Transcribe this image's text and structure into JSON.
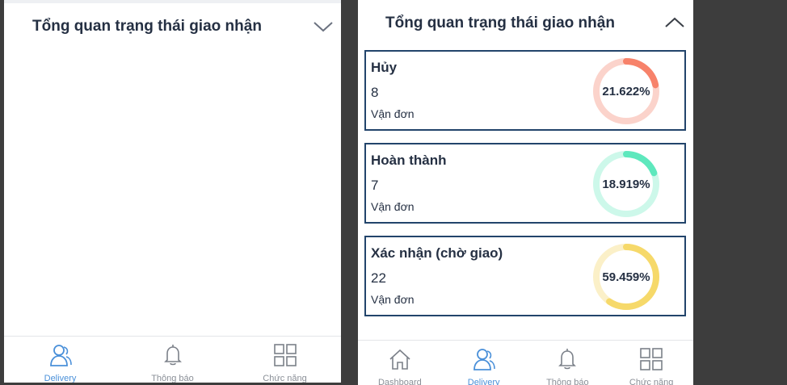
{
  "left_screen": {
    "section_title": "Tổng quan trạng thái giao nhận",
    "nav": [
      {
        "label": "Delivery",
        "icon": "delivery-person-icon",
        "active": true
      },
      {
        "label": "Thông báo",
        "icon": "bell-icon",
        "active": false
      },
      {
        "label": "Chức năng",
        "icon": "grid-icon",
        "active": false
      }
    ]
  },
  "right_screen": {
    "section_title": "Tổng quan trạng thái giao nhận",
    "cards": [
      {
        "label": "Hủy",
        "count": "8",
        "unit": "Vận đơn",
        "percent_text": "21.622%",
        "fraction": 0.21622,
        "color": "#f7826a",
        "track": "#fbd3cb"
      },
      {
        "label": "Hoàn thành",
        "count": "7",
        "unit": "Vận đơn",
        "percent_text": "18.919%",
        "fraction": 0.18919,
        "color": "#5ee8bd",
        "track": "#cdf8ea"
      },
      {
        "label": "Xác nhận (chờ giao)",
        "count": "22",
        "unit": "Vận đơn",
        "percent_text": "59.459%",
        "fraction": 0.59459,
        "color": "#f6d96a",
        "track": "#fbf0c8"
      }
    ],
    "nav": [
      {
        "label": "Dashboard",
        "icon": "home-icon",
        "active": false
      },
      {
        "label": "Delivery",
        "icon": "delivery-person-icon",
        "active": true
      },
      {
        "label": "Thông báo",
        "icon": "bell-icon",
        "active": false
      },
      {
        "label": "Chức năng",
        "icon": "grid-icon",
        "active": false
      }
    ]
  },
  "colors": {
    "card_border": "#22446b",
    "active_nav": "#4a90d9",
    "inactive_nav": "#8a8f97",
    "text": "#253043"
  }
}
